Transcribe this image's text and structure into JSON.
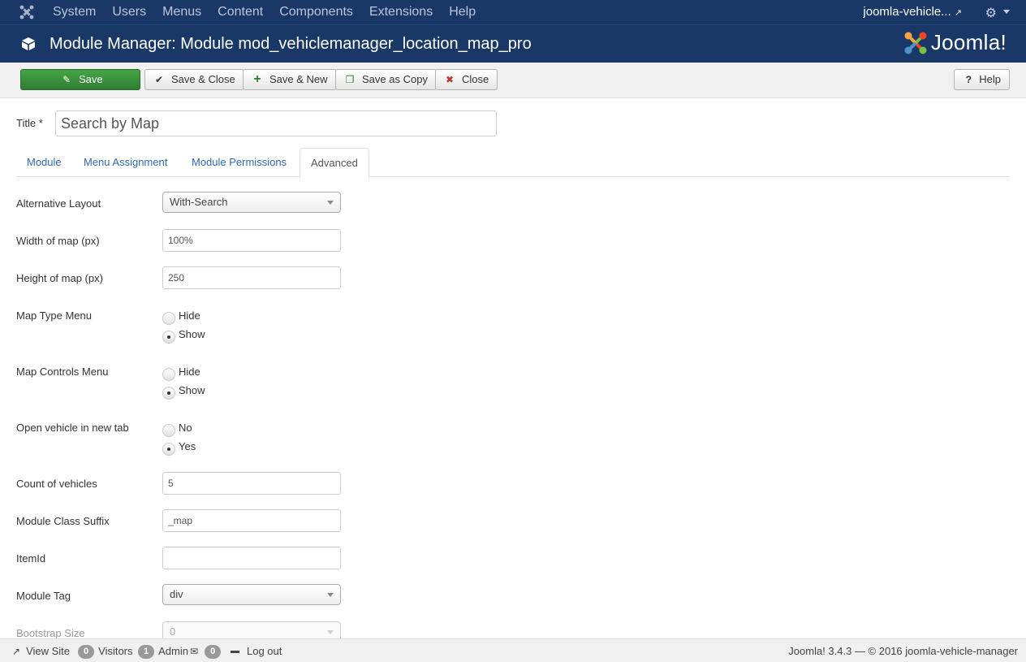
{
  "topnav": {
    "items": [
      "System",
      "Users",
      "Menus",
      "Content",
      "Components",
      "Extensions",
      "Help"
    ],
    "site_link": "joomla-vehicle..."
  },
  "header": {
    "title": "Module Manager: Module mod_vehiclemanager_location_map_pro",
    "logo_text": "Joomla!"
  },
  "toolbar": {
    "save": "Save",
    "save_close": "Save & Close",
    "save_new": "Save & New",
    "save_copy": "Save as Copy",
    "close": "Close",
    "help": "Help"
  },
  "form": {
    "title_label": "Title *",
    "title_value": "Search by Map"
  },
  "tabs": [
    "Module",
    "Menu Assignment",
    "Module Permissions",
    "Advanced"
  ],
  "advanced": {
    "alt_layout": {
      "label": "Alternative Layout",
      "value": "With-Search"
    },
    "width": {
      "label": "Width of map (px)",
      "value": "100%"
    },
    "height": {
      "label": "Height of map (px)",
      "value": "250"
    },
    "map_type_menu": {
      "label": "Map Type Menu",
      "options": [
        "Hide",
        "Show"
      ],
      "selected": "Show"
    },
    "map_controls_menu": {
      "label": "Map Controls Menu",
      "options": [
        "Hide",
        "Show"
      ],
      "selected": "Show"
    },
    "open_new_tab": {
      "label": "Open vehicle in new tab",
      "options": [
        "No",
        "Yes"
      ],
      "selected": "Yes"
    },
    "count": {
      "label": "Count of vehicles",
      "value": "5"
    },
    "class_suffix": {
      "label": "Module Class Suffix",
      "value": "_map"
    },
    "itemid": {
      "label": "ItemId",
      "value": ""
    },
    "module_tag": {
      "label": "Module Tag",
      "value": "div"
    },
    "bootstrap_size": {
      "label": "Bootstrap Size",
      "value": "0"
    }
  },
  "footer": {
    "view_site": "View Site",
    "visitors_count": "0",
    "visitors": "Visitors",
    "admin_count": "1",
    "admin": "Admin",
    "messages_count": "0",
    "logout": "Log out",
    "version": "Joomla! 3.4.3 — © 2016 joomla-vehicle-manager"
  },
  "colors": {
    "nav_bg": "#1a3867",
    "save_green": "#3a8f3c",
    "link_blue": "#2a69b8"
  }
}
